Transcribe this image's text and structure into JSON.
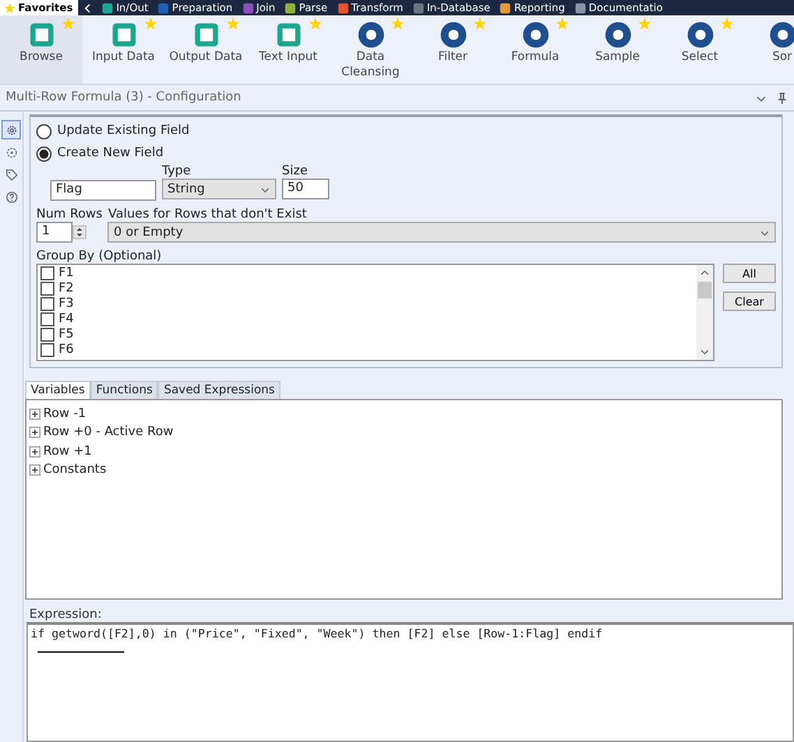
{
  "categories": [
    {
      "label": "Favorites",
      "selected": true,
      "color": "#ffd700"
    },
    {
      "label": "In/Out",
      "selected": false,
      "color": "#1aa68f"
    },
    {
      "label": "Preparation",
      "selected": false,
      "color": "#1f5fb8"
    },
    {
      "label": "Join",
      "selected": false,
      "color": "#8a4fb8"
    },
    {
      "label": "Parse",
      "selected": false,
      "color": "#8fb33a"
    },
    {
      "label": "Transform",
      "selected": false,
      "color": "#e8502f"
    },
    {
      "label": "In-Database",
      "selected": false,
      "color": "#6b7380"
    },
    {
      "label": "Reporting",
      "selected": false,
      "color": "#e39a3b"
    },
    {
      "label": "Documentatio",
      "selected": false,
      "color": "#8a93a3"
    }
  ],
  "tools": [
    {
      "label": "Browse",
      "kind": "teal",
      "selected": true,
      "starred": true
    },
    {
      "label": "Input Data",
      "kind": "teal",
      "selected": false,
      "starred": true
    },
    {
      "label": "Output Data",
      "kind": "teal",
      "selected": false,
      "starred": true
    },
    {
      "label": "Text Input",
      "kind": "teal",
      "selected": false,
      "starred": true
    },
    {
      "label": "Data Cleansing",
      "kind": "blue",
      "selected": false,
      "starred": true
    },
    {
      "label": "Filter",
      "kind": "blue",
      "selected": false,
      "starred": true
    },
    {
      "label": "Formula",
      "kind": "blue",
      "selected": false,
      "starred": true
    },
    {
      "label": "Sample",
      "kind": "blue",
      "selected": false,
      "starred": true
    },
    {
      "label": "Select",
      "kind": "blue",
      "selected": false,
      "starred": true
    },
    {
      "label": "Sor",
      "kind": "blue",
      "selected": false
    }
  ],
  "config_title": "Multi-Row Formula (3) - Configuration",
  "side_icons": [
    {
      "kind": "gear",
      "selected": true
    },
    {
      "kind": "cog",
      "selected": false
    },
    {
      "kind": "tag",
      "selected": false
    },
    {
      "kind": "help",
      "selected": false
    }
  ],
  "field_mode": [
    {
      "label": "Update Existing Field",
      "selected": false
    },
    {
      "label": "Create New  Field",
      "selected": true
    }
  ],
  "new_field": {
    "name": "Flag",
    "type_label": "Type",
    "type": "String",
    "size_label": "Size",
    "size": "50"
  },
  "num_rows": {
    "label": "Num Rows",
    "value": "1"
  },
  "missing_rows": {
    "label": "Values for Rows that don't Exist",
    "value": "0 or Empty"
  },
  "group_by": {
    "label": "Group By (Optional)",
    "items": [
      {
        "label": "F1",
        "checked": false
      },
      {
        "label": "F2",
        "checked": false
      },
      {
        "label": "F3",
        "checked": false
      },
      {
        "label": "F4",
        "checked": false
      },
      {
        "label": "F5",
        "checked": false
      },
      {
        "label": "F6",
        "checked": false
      }
    ],
    "buttons": [
      "All",
      "Clear"
    ]
  },
  "tabs": [
    {
      "label": "Variables",
      "selected": true
    },
    {
      "label": "Functions",
      "selected": false
    },
    {
      "label": "Saved Expressions",
      "selected": false
    }
  ],
  "variables": [
    {
      "label": "Row -1",
      "expanded": false
    },
    {
      "label": "Row +0 - Active Row",
      "expanded": false
    },
    {
      "label": "Row +1",
      "expanded": false
    },
    {
      "label": "Constants",
      "expanded": false
    }
  ],
  "expression": {
    "label": "Expression:",
    "value": "if getword([F2],0) in (\"Price\", \"Fixed\", \"Week\") then [F2] else [Row-1:Flag] endif"
  }
}
